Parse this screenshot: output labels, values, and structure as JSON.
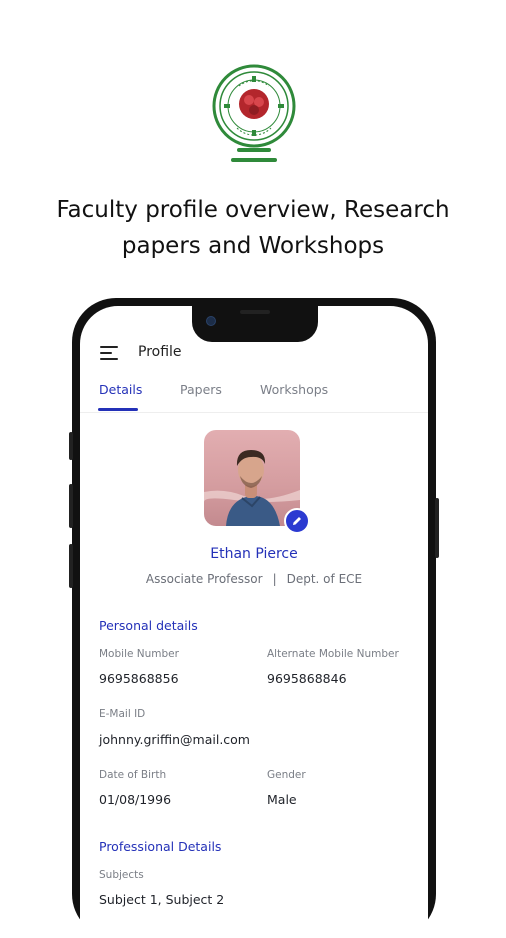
{
  "headline": {
    "line1": "Faculty profile overview, Research",
    "line2": "papers and Workshops"
  },
  "logo": {
    "icon": "university-seal-icon",
    "colors": {
      "ring": "#2f8a3a",
      "emblem": "#b3262c"
    }
  },
  "app": {
    "title": "Profile",
    "tabs": [
      {
        "label": "Details",
        "active": true
      },
      {
        "label": "Papers",
        "active": false
      },
      {
        "label": "Workshops",
        "active": false
      }
    ],
    "accent": "#2431b8"
  },
  "profile": {
    "name": "Ethan Pierce",
    "designation": "Associate Professor",
    "separator": "|",
    "department": "Dept. of ECE"
  },
  "personal": {
    "title": "Personal details",
    "mobile_label": "Mobile Number",
    "mobile_value": "9695868856",
    "alt_mobile_label": "Alternate Mobile Number",
    "alt_mobile_value": "9695868846",
    "email_label": "E-Mail ID",
    "email_value": "johnny.griffin@mail.com",
    "dob_label": "Date of Birth",
    "dob_value": "01/08/1996",
    "gender_label": "Gender",
    "gender_value": "Male"
  },
  "professional": {
    "title": "Professional Details",
    "subjects_label": "Subjects",
    "subjects_value": "Subject 1, Subject 2"
  }
}
